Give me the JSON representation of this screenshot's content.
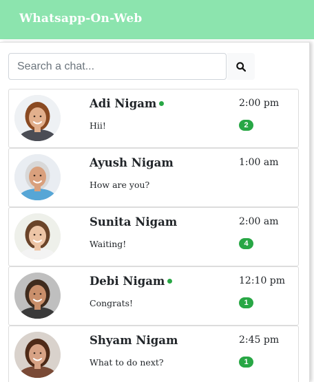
{
  "navbar": {
    "brand": "Whatsapp-On-Web"
  },
  "search": {
    "placeholder": "Search a chat...",
    "value": "",
    "icon": "search-icon"
  },
  "chats": [
    {
      "name": "Adi Nigam",
      "online": true,
      "message": "Hii!",
      "time": "2:00 pm",
      "unread": "2",
      "avatar": {
        "skin": "#e2b08d",
        "hair": "#8a4a22",
        "shirt": "#4b4d55",
        "bg": "#eef1f4"
      }
    },
    {
      "name": "Ayush Nigam",
      "online": false,
      "message": "How are you?",
      "time": "1:00 am",
      "unread": "",
      "avatar": {
        "skin": "#d9a07d",
        "hair": "#d8d8d8",
        "shirt": "#56a6d6",
        "bg": "#e9edf2"
      }
    },
    {
      "name": "Sunita Nigam",
      "online": false,
      "message": "Waiting!",
      "time": "2:00 am",
      "unread": "4",
      "avatar": {
        "skin": "#edc5a6",
        "hair": "#6a4429",
        "shirt": "#f3f3f3",
        "bg": "#eef0ea"
      }
    },
    {
      "name": "Debi Nigam",
      "online": true,
      "message": "Congrats!",
      "time": "12:10 pm",
      "unread": "1",
      "avatar": {
        "skin": "#c98f6b",
        "hair": "#3f2b1d",
        "shirt": "#3a3a3a",
        "bg": "#bfbfbf"
      }
    },
    {
      "name": "Shyam Nigam",
      "online": false,
      "message": "What to do next?",
      "time": "2:45 pm",
      "unread": "1",
      "avatar": {
        "skin": "#d7a285",
        "hair": "#4e2a18",
        "shirt": "#7a4a36",
        "bg": "#d9d2cc"
      }
    }
  ],
  "colors": {
    "navbar": "#8ce4ae",
    "online": "#28a745",
    "badge": "#28a745"
  }
}
